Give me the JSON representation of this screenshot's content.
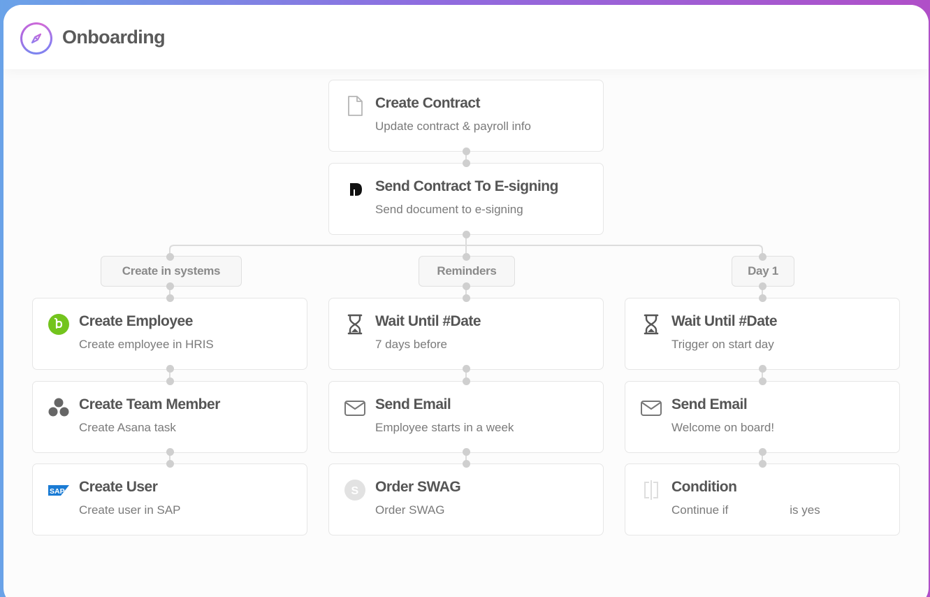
{
  "app": {
    "title": "Onboarding",
    "logo_icon": "compass-icon"
  },
  "main_flow": [
    {
      "title": "Create Contract",
      "subtitle": "Update contract & payroll info",
      "icon": "document-icon"
    },
    {
      "title": "Send Contract To E-signing",
      "subtitle": "Send document to e-signing",
      "icon": "esign-logo-icon"
    }
  ],
  "branches": [
    {
      "label": "Create in systems",
      "steps": [
        {
          "title": "Create Employee",
          "subtitle": "Create employee in HRIS",
          "icon": "bamboohr-logo-icon"
        },
        {
          "title": "Create Team Member",
          "subtitle": "Create Asana task",
          "icon": "asana-logo-icon"
        },
        {
          "title": "Create User",
          "subtitle": "Create user in SAP",
          "icon": "sap-logo-icon"
        }
      ]
    },
    {
      "label": "Reminders",
      "steps": [
        {
          "title": "Wait Until #Date",
          "subtitle": "7 days before",
          "icon": "hourglass-icon"
        },
        {
          "title": "Send Email",
          "subtitle": "Employee starts in a week",
          "icon": "mail-icon"
        },
        {
          "title": "Order SWAG",
          "subtitle": "Order SWAG",
          "icon": "swag-logo-icon"
        }
      ]
    },
    {
      "label": "Day 1",
      "steps": [
        {
          "title": "Wait Until #Date",
          "subtitle": "Trigger on start day",
          "icon": "hourglass-icon"
        },
        {
          "title": "Send Email",
          "subtitle": "Welcome on board!",
          "icon": "mail-icon"
        },
        {
          "title": "Condition",
          "subtitle_before": "Continue if",
          "subtitle_after": "is yes",
          "icon": "condition-split-icon"
        }
      ]
    }
  ],
  "colors": {
    "accent_gradient": [
      "#6aa3e8",
      "#b04fc8"
    ],
    "connector": "#cfcfcf",
    "bamboohr_green": "#73c41d",
    "sap_blue": "#1a7bd4"
  }
}
